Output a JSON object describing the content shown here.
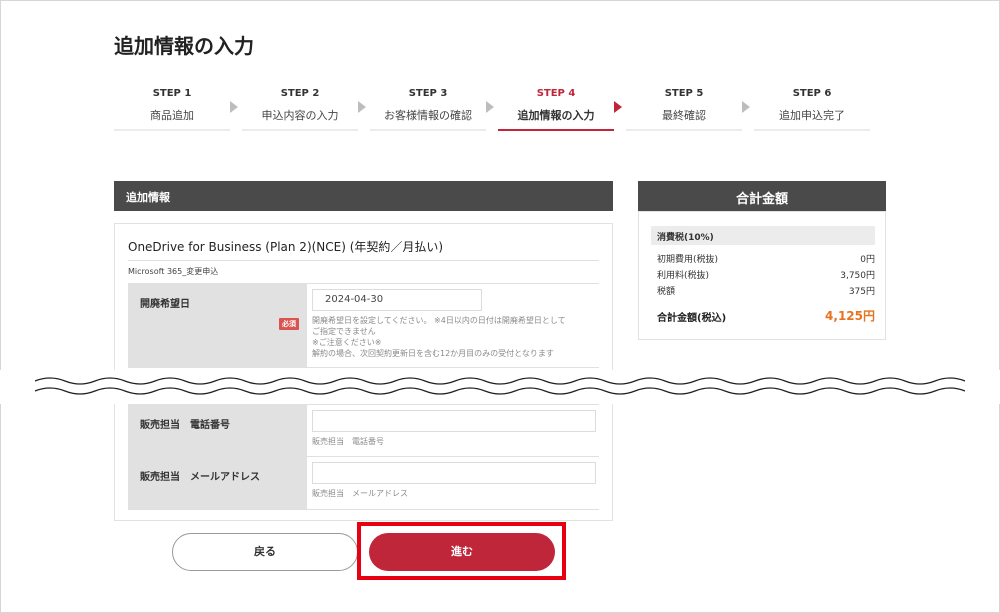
{
  "page": {
    "title": "追加情報の入力"
  },
  "steps": [
    {
      "num": "STEP 1",
      "label": "商品追加"
    },
    {
      "num": "STEP 2",
      "label": "申込内容の入力"
    },
    {
      "num": "STEP 3",
      "label": "お客様情報の確認"
    },
    {
      "num": "STEP 4",
      "label": "追加情報の入力"
    },
    {
      "num": "STEP 5",
      "label": "最終確認"
    },
    {
      "num": "STEP 6",
      "label": "追加申込完了"
    }
  ],
  "section": {
    "title": "追加情報"
  },
  "product": {
    "name": "OneDrive for Business (Plan 2)(NCE) (年契約／月払い)",
    "sub": "Microsoft 365_変更申込"
  },
  "fields": {
    "cancel_date": {
      "label": "開廃希望日",
      "required": "必須",
      "value": "2024-04-30",
      "hint1": "開廃希望日を設定してください。 ※4日以内の日付は開廃希望日として",
      "hint2": "ご指定できません",
      "hint3": "※ご注意ください※",
      "hint4": "解約の場合、次回契約更新日を含む12か月目のみの受付となります"
    },
    "sales_phone": {
      "label": "販売担当　電話番号",
      "hint": "販売担当　電話番号"
    },
    "sales_email": {
      "label": "販売担当　メールアドレス",
      "hint": "販売担当　メールアドレス"
    }
  },
  "summary": {
    "title": "合計金額",
    "tax_head": "消費税(10%)",
    "rows": [
      {
        "label": "初期費用(税抜)",
        "value": "0円"
      },
      {
        "label": "利用料(税抜)",
        "value": "3,750円"
      },
      {
        "label": "税額",
        "value": "375円"
      }
    ],
    "total_label": "合計金額(税込)",
    "total_value": "4,125円"
  },
  "buttons": {
    "back": "戻る",
    "next": "進む"
  },
  "colors": {
    "accent": "#c0263a",
    "total": "#e8731f",
    "highlight": "#e60012"
  }
}
